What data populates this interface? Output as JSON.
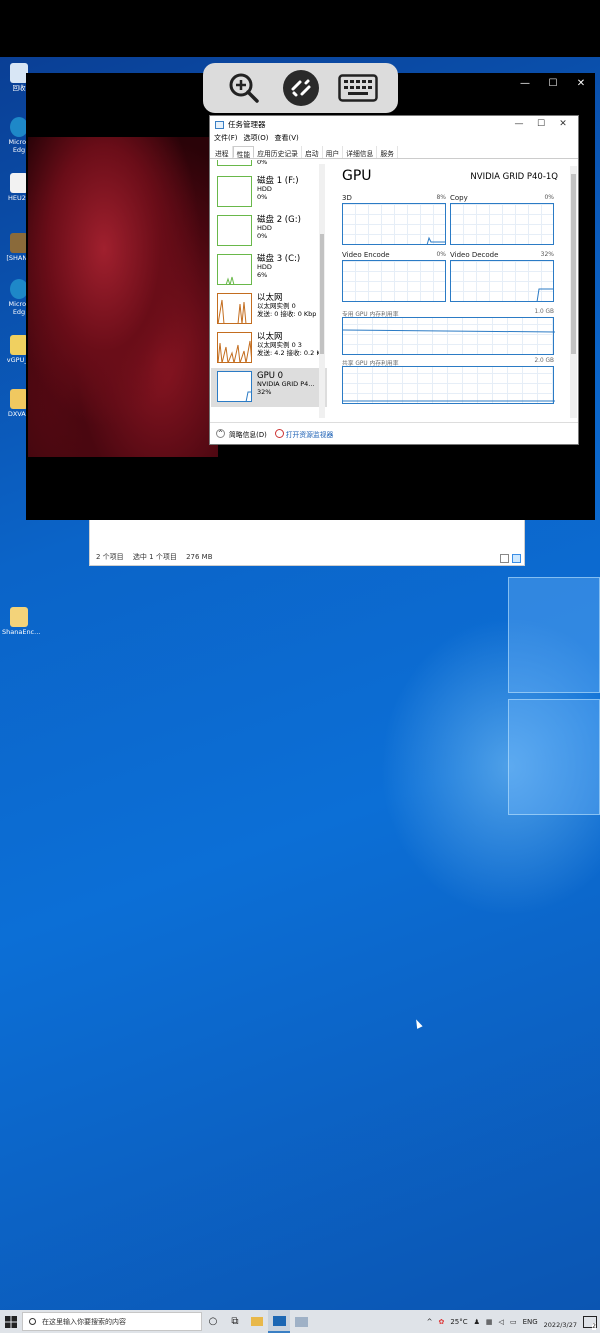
{
  "desktop": {
    "icons": [
      {
        "label": "回收",
        "color": "#d8e6f5"
      },
      {
        "label": "Micros Edg",
        "color": "#1e88c8"
      },
      {
        "label": "HEU24",
        "color": "#f2f2f2"
      },
      {
        "label": "[SHANA",
        "color": "#8a6a3a"
      },
      {
        "label": "Micros Edg",
        "color": "#1e88c8"
      },
      {
        "label": "vGPU_L",
        "color": "#f0d060"
      },
      {
        "label": "DXVAC",
        "color": "#f0c860"
      },
      {
        "label": "ShanaEnc...",
        "color": "#f3d37a"
      }
    ]
  },
  "explorer": {
    "status_items": "2 个项目",
    "status_selected": "选中 1 个项目",
    "status_size": "276 MB"
  },
  "remote_window": {
    "close_glyph": "✕",
    "max_glyph": "☐",
    "min_glyph": "—"
  },
  "task_manager": {
    "title": "任务管理器",
    "menu": [
      "文件(F)",
      "选项(O)",
      "查看(V)"
    ],
    "tabs": [
      "进程",
      "性能",
      "应用历史记录",
      "启动",
      "用户",
      "详细信息",
      "服务"
    ],
    "active_tab": "性能",
    "devices": [
      {
        "name": "",
        "type": "HDD",
        "value": "0%",
        "kind": "disk"
      },
      {
        "name": "磁盘 1 (F:)",
        "type": "HDD",
        "value": "0%",
        "kind": "disk"
      },
      {
        "name": "磁盘 2 (G:)",
        "type": "HDD",
        "value": "0%",
        "kind": "disk"
      },
      {
        "name": "磁盘 3 (C:)",
        "type": "HDD",
        "value": "6%",
        "kind": "disk"
      },
      {
        "name": "以太网",
        "type": "以太网实例 0",
        "value": "发送: 0 接收: 0 Kbp",
        "kind": "eth"
      },
      {
        "name": "以太网",
        "type": "以太网实例 0 3",
        "value": "发送: 4.2 接收: 0.2 K",
        "kind": "eth"
      },
      {
        "name": "GPU 0",
        "type": "NVIDIA GRID P4...",
        "value": "32%",
        "kind": "gpu"
      }
    ],
    "gpu_heading": "GPU",
    "gpu_model": "NVIDIA GRID P40-1Q",
    "engines": [
      {
        "label": "3D",
        "pct": "8%"
      },
      {
        "label": "Copy",
        "pct": "0%"
      },
      {
        "label": "Video Encode",
        "pct": "0%"
      },
      {
        "label": "Video Decode",
        "pct": "32%"
      }
    ],
    "dedicated_mem": {
      "label": "专用 GPU 内存利用率",
      "max": "1.0 GB"
    },
    "shared_mem": {
      "label": "共享 GPU 内存利用率",
      "max": "2.0 GB"
    },
    "footer_summary": "简略信息(D)",
    "footer_link": "打开资源监视器"
  },
  "taskbar": {
    "search_placeholder": "在这里输入你要搜索的内容",
    "temperature": "25°C",
    "lang": "ENG",
    "date": "2022/3/27",
    "badge": "2"
  }
}
